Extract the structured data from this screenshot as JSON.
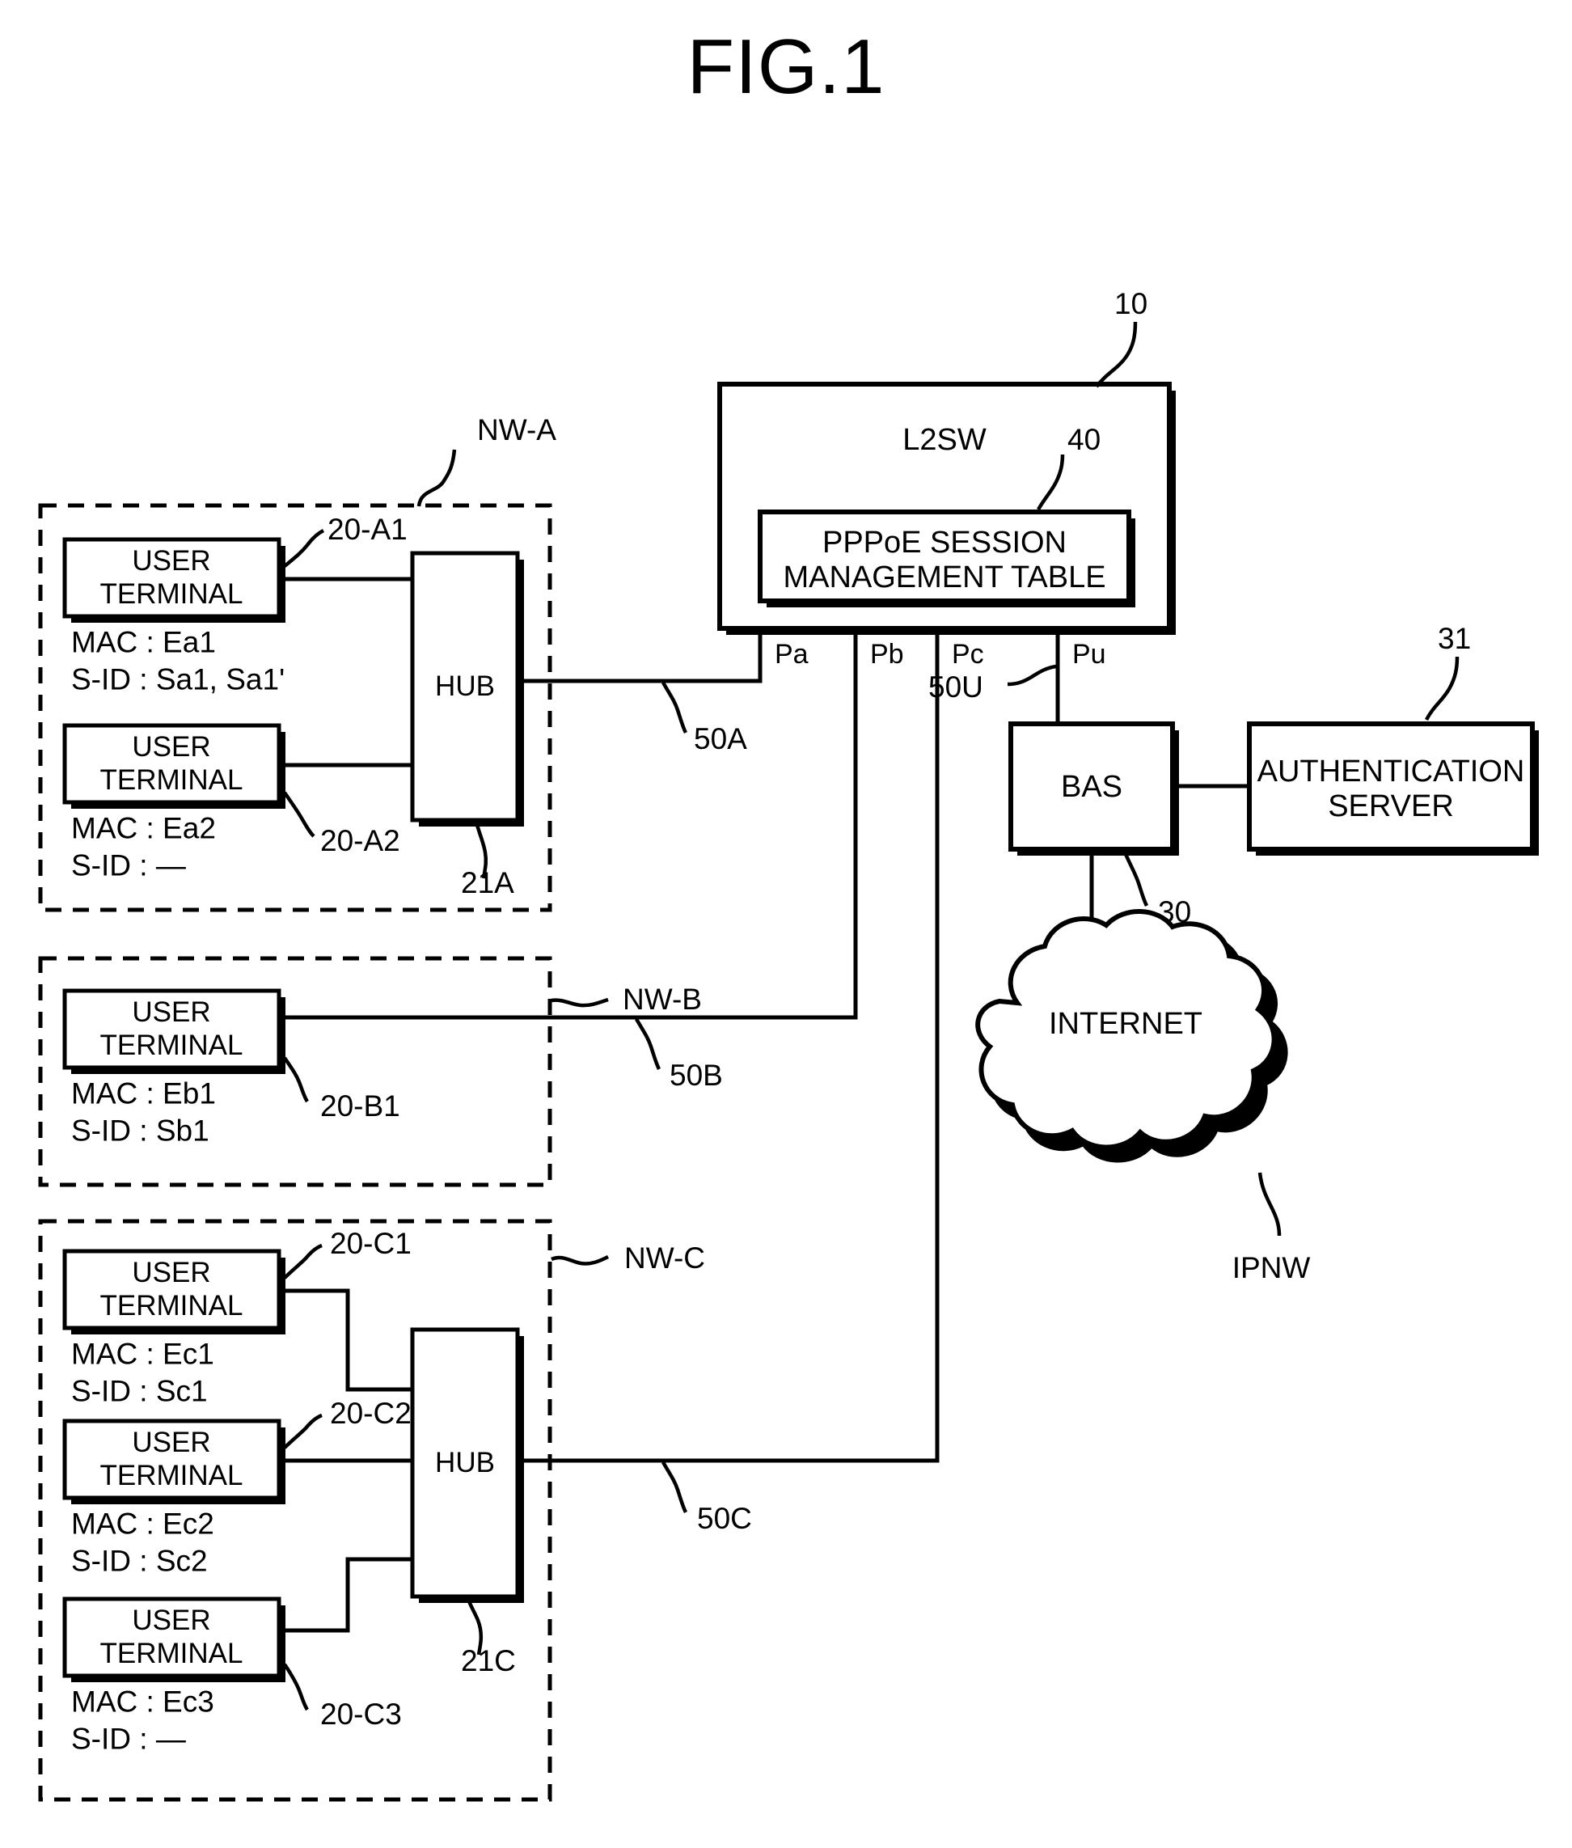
{
  "figure": {
    "title": "FIG.1"
  },
  "l2sw": {
    "label": "L2SW",
    "ref": "10",
    "table": {
      "line1": "PPPoE SESSION",
      "line2": "MANAGEMENT TABLE",
      "ref": "40"
    },
    "ports": [
      {
        "name": "Pa"
      },
      {
        "name": "Pb"
      },
      {
        "name": "Pc"
      },
      {
        "name": "Pu"
      }
    ]
  },
  "networks": [
    {
      "id": "nw-a",
      "label": "NW-A",
      "hub": {
        "label": "HUB",
        "ref": "21A"
      },
      "link": {
        "ref": "50A"
      },
      "terminals": [
        {
          "label_line1": "USER",
          "label_line2": "TERMINAL",
          "ref": "20-A1",
          "mac": "MAC : Ea1",
          "sid": "S-ID : Sa1, Sa1'"
        },
        {
          "label_line1": "USER",
          "label_line2": "TERMINAL",
          "ref": "20-A2",
          "mac": "MAC : Ea2",
          "sid": "S-ID : —"
        }
      ]
    },
    {
      "id": "nw-b",
      "label": "NW-B",
      "hub": null,
      "link": {
        "ref": "50B"
      },
      "terminals": [
        {
          "label_line1": "USER",
          "label_line2": "TERMINAL",
          "ref": "20-B1",
          "mac": "MAC : Eb1",
          "sid": "S-ID : Sb1"
        }
      ]
    },
    {
      "id": "nw-c",
      "label": "NW-C",
      "hub": {
        "label": "HUB",
        "ref": "21C"
      },
      "link": {
        "ref": "50C"
      },
      "terminals": [
        {
          "label_line1": "USER",
          "label_line2": "TERMINAL",
          "ref": "20-C1",
          "mac": "MAC : Ec1",
          "sid": "S-ID : Sc1"
        },
        {
          "label_line1": "USER",
          "label_line2": "TERMINAL",
          "ref": "20-C2",
          "mac": "MAC : Ec2",
          "sid": "S-ID : Sc2"
        },
        {
          "label_line1": "USER",
          "label_line2": "TERMINAL",
          "ref": "20-C3",
          "mac": "MAC : Ec3",
          "sid": "S-ID : —"
        }
      ]
    }
  ],
  "bas": {
    "label": "BAS",
    "ref": "30",
    "uplink_ref": "50U"
  },
  "auth_server": {
    "line1": "AUTHENTICATION",
    "line2": "SERVER",
    "ref": "31"
  },
  "internet": {
    "label": "INTERNET",
    "ref": "IPNW"
  },
  "colors": {
    "stroke": "#000000",
    "background": "#ffffff"
  }
}
